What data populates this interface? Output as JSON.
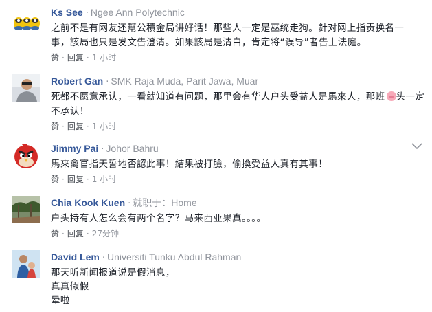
{
  "comments": [
    {
      "name": "Ks See",
      "affiliation": "Ngee Ann Polytechnic",
      "text": "之前不是有网友还幫公積金局讲好话！那些人一定是巫统走狗。針对网上指责换名一事，該局也只是发文告澄清。如果該局是清白，肯定将“误导”者告上法庭。",
      "like": "赞",
      "reply": "回复",
      "time": "1 小时"
    },
    {
      "name": "Robert Gan",
      "affiliation": "SMK Raja Muda, Parit Jawa, Muar",
      "text": "死都不愿意承认，一看就知道有问题，那里会有华人户头受益人是馬來人，那班",
      "text_end": "头一定不承认！",
      "like": "赞",
      "reply": "回复",
      "time": "1 小时"
    },
    {
      "name": "Jimmy Pai",
      "affiliation": "Johor Bahru",
      "text": "馬來禽官指天誓地否認此事！結果被打臉，偷換受益人真有其事！",
      "like": "赞",
      "reply": "回复",
      "time": "1 小时"
    },
    {
      "name": "Chia Kook Kuen",
      "affiliation": "就职于：Home",
      "text": "户头持有人怎么会有两个名字？马来西亚果真。。。。",
      "like": "赞",
      "reply": "回复",
      "time": "27分钟"
    },
    {
      "name": "David Lem",
      "affiliation": "Universiti Tunku Abdul Rahman",
      "text": "那天听新闻报道说是假消息，\n真真假假\n晕啦"
    }
  ],
  "separator": "·",
  "icons": {
    "chevron": "chevron-down-icon",
    "pig": "pig-emoji-icon"
  },
  "colors": {
    "name": "#365899",
    "meta": "#90949c",
    "text": "#1d2129"
  }
}
